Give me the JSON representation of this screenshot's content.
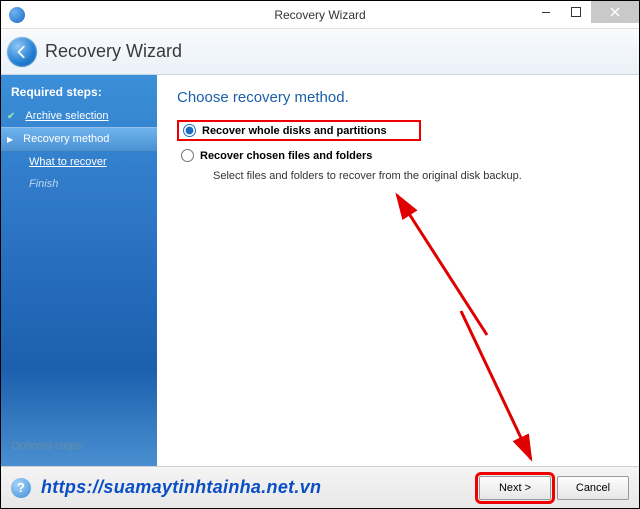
{
  "window": {
    "title": "Recovery Wizard"
  },
  "header": {
    "title": "Recovery Wizard"
  },
  "sidebar": {
    "heading": "Required steps:",
    "items": [
      {
        "label": "Archive selection",
        "state": "completed"
      },
      {
        "label": "Recovery method",
        "state": "current"
      },
      {
        "label": "What to recover",
        "state": "link"
      },
      {
        "label": "Finish",
        "state": "disabled"
      }
    ],
    "optional_toggle": "Optional steps:"
  },
  "main": {
    "heading": "Choose recovery method.",
    "options": [
      {
        "id": "whole",
        "label": "Recover whole disks and partitions",
        "selected": true,
        "highlighted": true
      },
      {
        "id": "files",
        "label": "Recover chosen files and folders",
        "selected": false,
        "description": "Select files and folders to recover from the original disk backup."
      }
    ]
  },
  "footer": {
    "watermark": "https://suamaytinhtainha.net.vn",
    "next_label": "Next >",
    "cancel_label": "Cancel",
    "next_highlighted": true
  },
  "annotation_color": "#e00000"
}
